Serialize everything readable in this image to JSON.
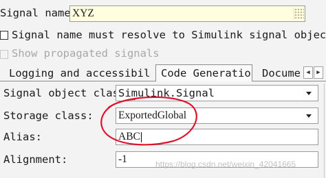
{
  "signal_name": {
    "label": "Signal name:",
    "value": "XYZ"
  },
  "must_resolve": {
    "label": "Signal name must resolve to Simulink signal object",
    "checked": false
  },
  "show_propagated": {
    "label": "Show propagated signals",
    "checked": false,
    "enabled": false
  },
  "tabs": [
    {
      "label": "Logging and accessibility",
      "active": false
    },
    {
      "label": "Code Generation",
      "active": true
    },
    {
      "label": "Documentation",
      "active": false
    }
  ],
  "signal_object_class": {
    "label": "Signal object class:",
    "value": "Simulink.Signal"
  },
  "storage_class": {
    "label": "Storage class:",
    "value": "ExportedGlobal"
  },
  "alias": {
    "label": "Alias:",
    "value": "ABC"
  },
  "alignment": {
    "label": "Alignment:",
    "value": "-1"
  },
  "watermark": "https://blog.csdn.net/weixin_42041665",
  "annotation_color": "#e0102a",
  "field_highlight_color": "#ffffe0"
}
